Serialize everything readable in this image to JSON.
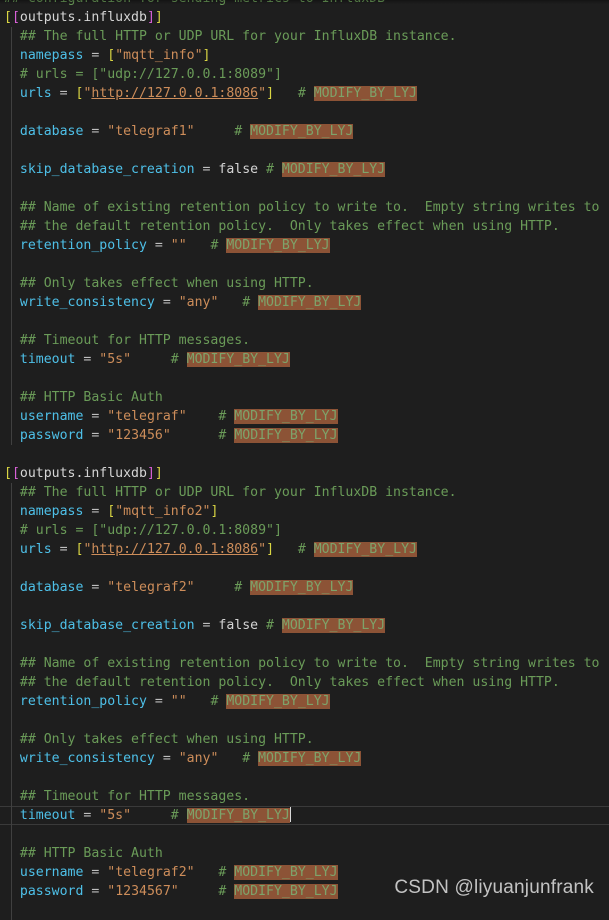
{
  "editor": {
    "background": "#1e1e1e",
    "comment_color": "#6a9b58",
    "key_color": "#4ec0e8",
    "string_color": "#cd8d5a",
    "bracket_color": "#d9d543",
    "highlight_bg": "#8c5336",
    "highlight_fg": "#7ea36a",
    "watermark": "CSDN @liyuanjunfrank",
    "marker_tag": "MODIFY_BY_LYJ"
  },
  "lines": [
    {
      "id": "l01",
      "kind": "comment-partial",
      "text": "## Configuration for sending metrics to InfluxDB",
      "indent": false
    },
    {
      "id": "l02",
      "kind": "table",
      "table_open": "[[",
      "table_name": "outputs.influxdb",
      "table_close": "]]",
      "indent": false
    },
    {
      "id": "l03",
      "kind": "comment",
      "text": "## The full HTTP or UDP URL for your InfluxDB instance.",
      "indent": true
    },
    {
      "id": "l04",
      "kind": "kv-array",
      "key": "namepass",
      "value": "\"mqtt_info\"",
      "indent": true
    },
    {
      "id": "l05",
      "kind": "comment",
      "text": "# urls = [\"udp://127.0.0.1:8089\"]",
      "indent": true
    },
    {
      "id": "l06",
      "kind": "kv-url",
      "key": "urls",
      "url": "http://127.0.0.1:8086",
      "comment": "#",
      "marker": "MODIFY_BY_LYJ",
      "indent": true
    },
    {
      "id": "l07",
      "kind": "blank",
      "indent": true
    },
    {
      "id": "l08",
      "kind": "kv",
      "key": "database",
      "value": "\"telegraf1\"",
      "comment": "#",
      "marker": "MODIFY_BY_LYJ",
      "indent": true
    },
    {
      "id": "l09",
      "kind": "blank",
      "indent": true
    },
    {
      "id": "l10",
      "kind": "kv-bool",
      "key": "skip_database_creation",
      "value": "false",
      "comment": "#",
      "marker": "MODIFY_BY_LYJ",
      "indent": true
    },
    {
      "id": "l11",
      "kind": "blank",
      "indent": true
    },
    {
      "id": "l12",
      "kind": "comment",
      "text": "## Name of existing retention policy to write to.  Empty string writes to",
      "indent": true
    },
    {
      "id": "l13",
      "kind": "comment",
      "text": "## the default retention policy.  Only takes effect when using HTTP.",
      "indent": true
    },
    {
      "id": "l14",
      "kind": "kv",
      "key": "retention_policy",
      "value": "\"\"",
      "comment": "#",
      "marker": "MODIFY_BY_LYJ",
      "indent": true
    },
    {
      "id": "l15",
      "kind": "blank",
      "indent": true
    },
    {
      "id": "l16",
      "kind": "comment",
      "text": "## Only takes effect when using HTTP.",
      "indent": true
    },
    {
      "id": "l17",
      "kind": "kv",
      "key": "write_consistency",
      "value": "\"any\"",
      "comment": "#",
      "marker": "MODIFY_BY_LYJ",
      "indent": true
    },
    {
      "id": "l18",
      "kind": "blank",
      "indent": true
    },
    {
      "id": "l19",
      "kind": "comment",
      "text": "## Timeout for HTTP messages.",
      "indent": true
    },
    {
      "id": "l20",
      "kind": "kv",
      "key": "timeout",
      "value": "\"5s\"",
      "comment": "#",
      "marker": "MODIFY_BY_LYJ",
      "indent": true
    },
    {
      "id": "l21",
      "kind": "blank",
      "indent": true
    },
    {
      "id": "l22",
      "kind": "comment",
      "text": "## HTTP Basic Auth",
      "indent": true
    },
    {
      "id": "l23",
      "kind": "kv",
      "key": "username",
      "value": "\"telegraf\"",
      "comment": "#",
      "marker": "MODIFY_BY_LYJ",
      "indent": true
    },
    {
      "id": "l24",
      "kind": "kv",
      "key": "password",
      "value": "\"123456\"",
      "comment": "#",
      "marker": "MODIFY_BY_LYJ",
      "indent": true
    },
    {
      "id": "l25",
      "kind": "blank",
      "indent": false
    },
    {
      "id": "l26",
      "kind": "table",
      "table_open": "[[",
      "table_name": "outputs.influxdb",
      "table_close": "]]",
      "indent": false
    },
    {
      "id": "l27",
      "kind": "comment",
      "text": "## The full HTTP or UDP URL for your InfluxDB instance.",
      "indent": true
    },
    {
      "id": "l28",
      "kind": "kv-array",
      "key": "namepass",
      "value": "\"mqtt_info2\"",
      "indent": true
    },
    {
      "id": "l29",
      "kind": "comment",
      "text": "# urls = [\"udp://127.0.0.1:8089\"]",
      "indent": true
    },
    {
      "id": "l30",
      "kind": "kv-url",
      "key": "urls",
      "url": "http://127.0.0.1:8086",
      "comment": "#",
      "marker": "MODIFY_BY_LYJ",
      "indent": true
    },
    {
      "id": "l31",
      "kind": "blank",
      "indent": true
    },
    {
      "id": "l32",
      "kind": "kv",
      "key": "database",
      "value": "\"telegraf2\"",
      "comment": "#",
      "marker": "MODIFY_BY_LYJ",
      "indent": true
    },
    {
      "id": "l33",
      "kind": "blank",
      "indent": true
    },
    {
      "id": "l34",
      "kind": "kv-bool",
      "key": "skip_database_creation",
      "value": "false",
      "comment": "#",
      "marker": "MODIFY_BY_LYJ",
      "indent": true
    },
    {
      "id": "l35",
      "kind": "blank",
      "indent": true
    },
    {
      "id": "l36",
      "kind": "comment",
      "text": "## Name of existing retention policy to write to.  Empty string writes to",
      "indent": true
    },
    {
      "id": "l37",
      "kind": "comment",
      "text": "## the default retention policy.  Only takes effect when using HTTP.",
      "indent": true
    },
    {
      "id": "l38",
      "kind": "kv",
      "key": "retention_policy",
      "value": "\"\"",
      "comment": "#",
      "marker": "MODIFY_BY_LYJ",
      "indent": true
    },
    {
      "id": "l39",
      "kind": "blank",
      "indent": true
    },
    {
      "id": "l40",
      "kind": "comment",
      "text": "## Only takes effect when using HTTP.",
      "indent": true
    },
    {
      "id": "l41",
      "kind": "kv",
      "key": "write_consistency",
      "value": "\"any\"",
      "comment": "#",
      "marker": "MODIFY_BY_LYJ",
      "indent": true
    },
    {
      "id": "l42",
      "kind": "blank",
      "indent": true
    },
    {
      "id": "l43",
      "kind": "comment",
      "text": "## Timeout for HTTP messages.",
      "indent": true
    },
    {
      "id": "l44",
      "kind": "kv-cursor",
      "key": "timeout",
      "value": "\"5s\"",
      "comment": "#",
      "marker": "MODIFY_BY_LYJ",
      "indent": true,
      "active": true
    },
    {
      "id": "l45",
      "kind": "blank",
      "indent": true
    },
    {
      "id": "l46",
      "kind": "comment",
      "text": "## HTTP Basic Auth",
      "indent": true
    },
    {
      "id": "l47",
      "kind": "kv",
      "key": "username",
      "value": "\"telegraf2\"",
      "comment": "#",
      "marker": "MODIFY_BY_LYJ",
      "indent": true
    },
    {
      "id": "l48",
      "kind": "kv",
      "key": "password",
      "value": "\"1234567\"",
      "comment": "#",
      "marker": "MODIFY_BY_LYJ",
      "indent": true
    },
    {
      "id": "l49",
      "kind": "blank",
      "indent": true
    }
  ]
}
